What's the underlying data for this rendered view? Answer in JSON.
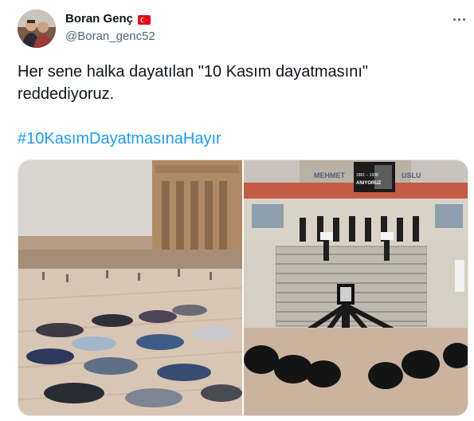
{
  "tweet": {
    "display_name": "Boran Genç",
    "handle": "@Boran_genc52",
    "text_lines": [
      "Her sene halka dayatılan \"10 Kasım dayatmasını\"",
      "reddediyoruz."
    ],
    "hashtag": "#10KasımDayatmasınaHayır"
  },
  "media": {
    "right_photo": {
      "school_sign": "MEHMET",
      "school_sign_2": "USLU",
      "banner_years": "1881 – 1938",
      "banner_caption": "ANIYORUZ"
    }
  },
  "colors": {
    "text": "#0f1419",
    "secondary": "#536471",
    "link": "#1d9bf0",
    "flag_red": "#e30a17"
  },
  "icons": [
    "more-icon",
    "turkey-flag-icon"
  ]
}
